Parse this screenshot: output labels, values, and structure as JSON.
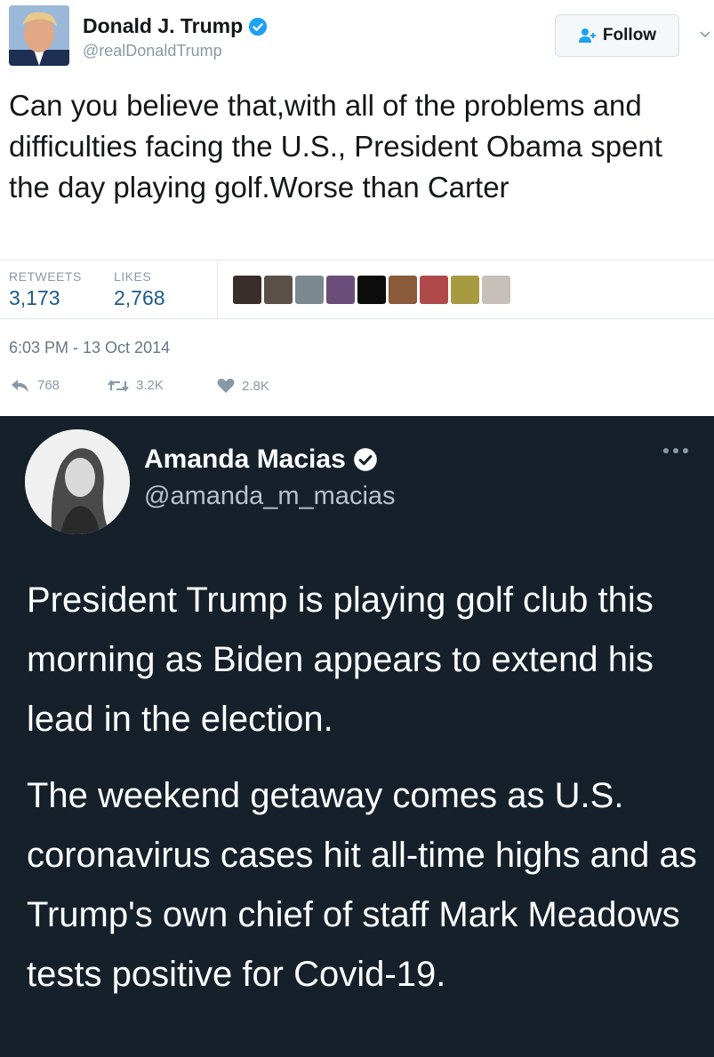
{
  "tweet1": {
    "name": "Donald J. Trump",
    "handle": "@realDonaldTrump",
    "follow_label": "Follow",
    "text": "Can you believe that,with all of the problems and difficulties facing the U.S., President Obama spent the day playing golf.Worse than Carter",
    "retweets_label": "RETWEETS",
    "retweets_value": "3,173",
    "likes_label": "LIKES",
    "likes_value": "2,768",
    "timestamp": "6:03 PM - 13 Oct 2014",
    "reply_count": "768",
    "retweet_count": "3.2K",
    "like_count": "2.8K",
    "liker_avatar_colors": [
      "#3a2e2a",
      "#5a5048",
      "#7b8a90",
      "#6b4f7a",
      "#0c0c0c",
      "#8a5a3a",
      "#b04a4a",
      "#a89a40",
      "#c8c0b8"
    ]
  },
  "tweet2": {
    "name": "Amanda Macias",
    "handle": "@amanda_m_macias",
    "paragraph1": "President Trump is playing golf club this morning as Biden appears to extend his lead in the election.",
    "paragraph2": "The weekend getaway comes as U.S. coronavirus cases hit all-time highs and as Trump's own chief of staff Mark Meadows tests positive for Covid-19."
  },
  "colors": {
    "light_bg": "#ffffff",
    "dark_bg": "#15202b",
    "verified": "#1da1f2",
    "stat_value": "#1b5a8a"
  }
}
